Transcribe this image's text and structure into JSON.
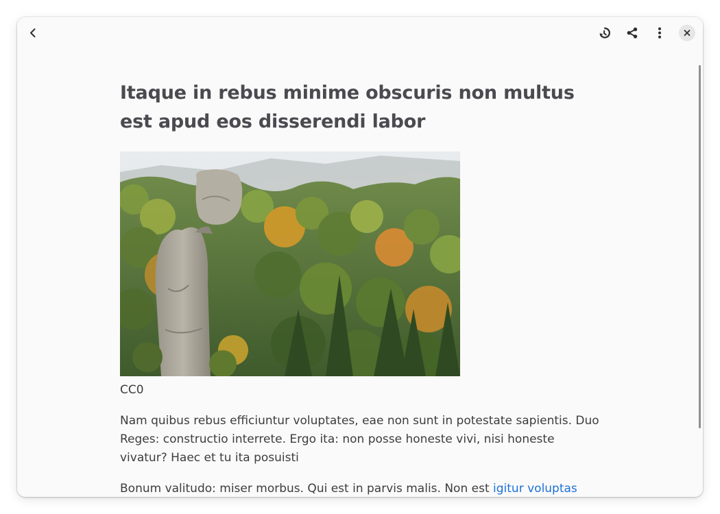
{
  "header": {
    "back_label": "Back",
    "sync_label": "Sync",
    "share_label": "Share",
    "menu_label": "Menu",
    "close_label": "Close"
  },
  "article": {
    "title": "Itaque in rebus minime obscuris non multus est apud eos disserendi labor",
    "image_caption": "CC0",
    "paragraphs": [
      {
        "text": "Nam quibus rebus efficiuntur voluptates, eae non sunt in potestate sapientis. Duo Reges: constructio interrete. Ergo ita: non posse honeste vivi, nisi honeste vivatur? Haec et tu ita posuisti"
      },
      {
        "text_before_link": "Bonum valitudo: miser morbus. Qui est in parvis malis. Non est ",
        "link_text": "igitur voluptas"
      }
    ]
  },
  "colors": {
    "window_bg": "#fafafa",
    "title_text": "#4a4a4f",
    "body_text": "#3d3d3d",
    "link": "#1c71d8",
    "close_button_bg": "#e6e6e6"
  },
  "icons": {
    "back": "chevron-left-icon",
    "sync": "sync-icon",
    "share": "share-icon",
    "menu": "view-more-vertical-icon",
    "close": "close-icon"
  }
}
